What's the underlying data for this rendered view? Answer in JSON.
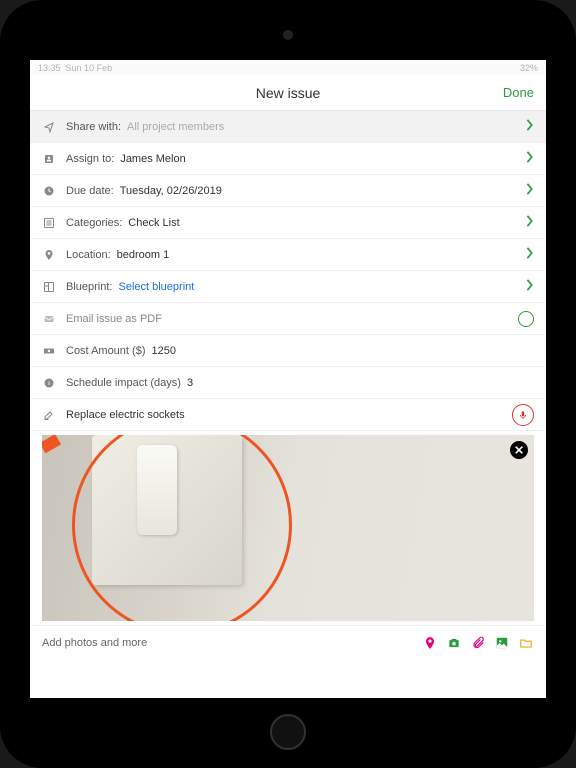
{
  "status_bar": {
    "time": "13:35",
    "date": "Sun 10 Feb",
    "battery": "32%"
  },
  "header": {
    "title": "New issue",
    "done": "Done"
  },
  "rows": {
    "share_with": {
      "label": "Share with:",
      "value": "All project members"
    },
    "assign_to": {
      "label": "Assign to:",
      "value": "James Melon"
    },
    "due_date": {
      "label": "Due date:",
      "value": "Tuesday, 02/26/2019"
    },
    "categories": {
      "label": "Categories:",
      "value": "Check List"
    },
    "location": {
      "label": "Location:",
      "value": "bedroom 1"
    },
    "blueprint": {
      "label": "Blueprint:",
      "value": "Select blueprint"
    },
    "email_pdf": {
      "label": "Email issue as PDF"
    },
    "cost_amount": {
      "label": "Cost Amount ($)",
      "value": "1250"
    },
    "schedule_impact": {
      "label": "Schedule impact (days)",
      "value": "3"
    },
    "description": {
      "value": "Replace electric sockets"
    }
  },
  "bottom": {
    "label": "Add photos and more"
  }
}
